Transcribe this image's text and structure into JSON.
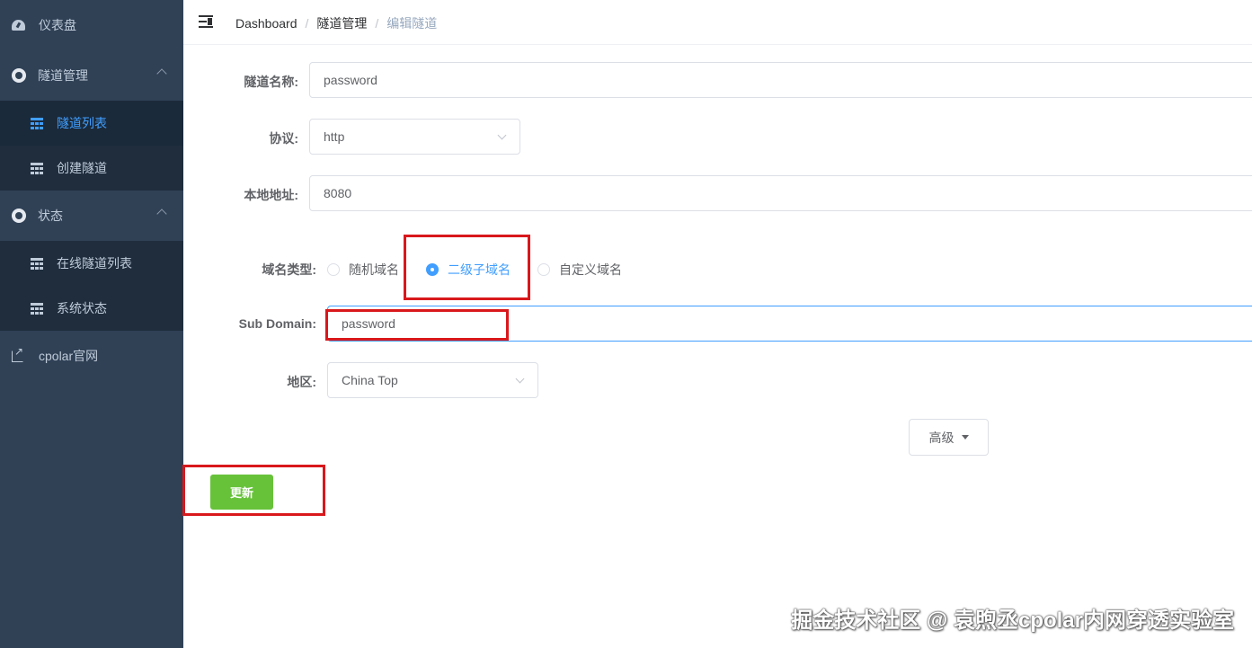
{
  "sidebar": {
    "dashboard": "仪表盘",
    "tunnel_mgmt": "隧道管理",
    "tunnel_list": "隧道列表",
    "create_tunnel": "创建隧道",
    "status": "状态",
    "online_tunnels": "在线隧道列表",
    "system_status": "系统状态",
    "website": "cpolar官网",
    "active_color": "#409eff",
    "bg_color": "#304156"
  },
  "breadcrumb": {
    "items": [
      "Dashboard",
      "隧道管理"
    ],
    "current": "编辑隧道",
    "separator": "/"
  },
  "form": {
    "name_label": "隧道名称:",
    "name_value": "password",
    "protocol_label": "协议:",
    "protocol_value": "http",
    "local_label": "本地地址:",
    "local_value": "8080",
    "domain_type_label": "域名类型:",
    "domain_types": [
      "随机域名",
      "二级子域名",
      "自定义域名"
    ],
    "domain_type_selected": "二级子域名",
    "subdomain_label": "Sub Domain:",
    "subdomain_value": "password",
    "region_label": "地区:",
    "region_value": "China Top",
    "advanced_label": "高级",
    "update_label": "更新"
  },
  "watermark": "掘金技术社区 @ 袁煦丞cpolar内网穿透实验室",
  "colors": {
    "primary": "#409eff",
    "success": "#67c23a",
    "highlight": "#d9181c"
  }
}
